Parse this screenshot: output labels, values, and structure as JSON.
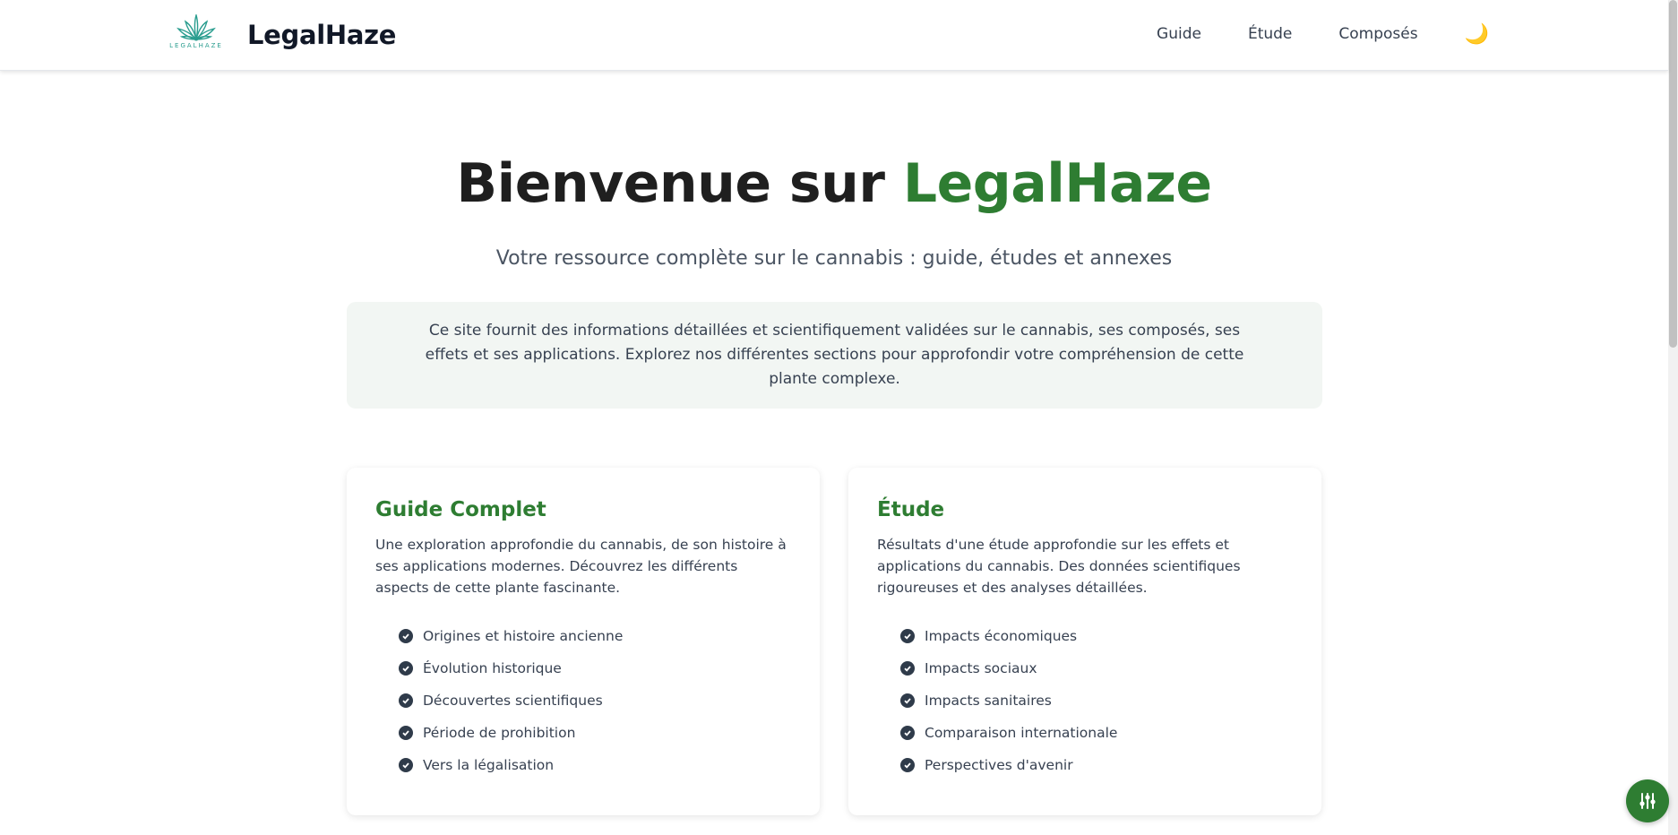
{
  "header": {
    "logo_small_text": "LEGALHAZE",
    "brand": "LegalHaze",
    "nav": [
      {
        "label": "Guide"
      },
      {
        "label": "Étude"
      },
      {
        "label": "Composés"
      }
    ],
    "theme_toggle_glyph": "🌙",
    "theme_toggle_icon": "moon-icon"
  },
  "hero": {
    "title_prefix": "Bienvenue sur ",
    "title_accent": "LegalHaze",
    "subtitle": "Votre ressource complète sur le cannabis : guide, études et annexes",
    "intro": "Ce site fournit des informations détaillées et scientifiquement validées sur le cannabis, ses composés, ses effets et ses applications. Explorez nos différentes sections pour approfondir votre compréhension de cette plante complexe."
  },
  "cards": [
    {
      "title": "Guide Complet",
      "description": "Une exploration approfondie du cannabis, de son histoire à ses applications modernes. Découvrez les différents aspects de cette plante fascinante.",
      "items": [
        "Origines et histoire ancienne",
        "Évolution historique",
        "Découvertes scientifiques",
        "Période de prohibition",
        "Vers la légalisation"
      ]
    },
    {
      "title": "Étude",
      "description": "Résultats d'une étude approfondie sur les effets et applications du cannabis. Des données scientifiques rigoureuses et des analyses détaillées.",
      "items": [
        "Impacts économiques",
        "Impacts sociaux",
        "Impacts sanitaires",
        "Comparaison internationale",
        "Perspectives d'avenir"
      ]
    }
  ],
  "colors": {
    "accent_green": "#2e7d32",
    "logo_teal": "#2a9d8f",
    "intro_bg": "#f2f6f3",
    "check_bg": "#2f3b4a"
  },
  "fab": {
    "icon": "sliders-icon"
  }
}
